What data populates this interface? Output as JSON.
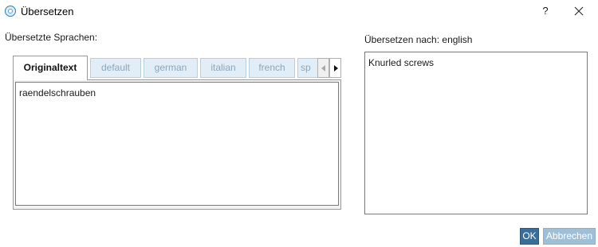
{
  "window": {
    "title": "Übersetzen",
    "help_label": "?"
  },
  "left_panel": {
    "label": "Übersetzte Sprachen:",
    "tabs": [
      {
        "label": "Originaltext",
        "active": true
      },
      {
        "label": "default",
        "active": false
      },
      {
        "label": "german",
        "active": false
      },
      {
        "label": "italian",
        "active": false
      },
      {
        "label": "french",
        "active": false
      },
      {
        "label": "sp",
        "active": false
      }
    ],
    "source_text": "raendelschrauben"
  },
  "right_panel": {
    "label": "Übersetzen nach: english",
    "translation_text": "Knurled screws"
  },
  "buttons": {
    "ok_label": "OK",
    "cancel_label": "Abbrechen"
  },
  "colors": {
    "primary_button": "#3a6e9a",
    "disabled_button": "#9fbfd6",
    "inactive_tab": "#e2eef7",
    "inactive_tab_text": "#8ea6b8"
  },
  "icons": {
    "app": "app-globe-icon",
    "close": "close-icon",
    "tab_left": "chevron-left-icon",
    "tab_right": "chevron-right-icon"
  }
}
